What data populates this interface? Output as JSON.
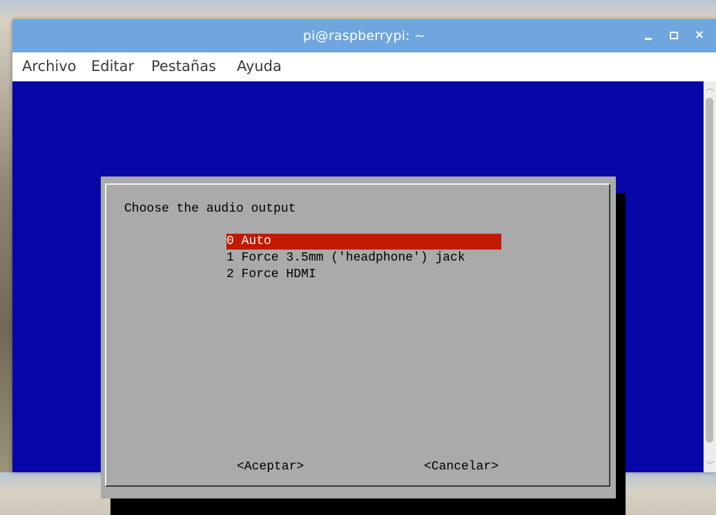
{
  "window": {
    "title": "pi@raspberrypi: ~",
    "controls": {
      "minimize": "_",
      "maximize": "□",
      "close": "×"
    }
  },
  "menubar": {
    "items": [
      "Archivo",
      "Editar",
      "Pestañas",
      "Ayuda"
    ]
  },
  "dialog": {
    "prompt": "Choose the audio output",
    "options": [
      {
        "label": "0 Auto",
        "selected": true
      },
      {
        "label": "1 Force 3.5mm ('headphone') jack",
        "selected": false
      },
      {
        "label": "2 Force HDMI",
        "selected": false
      }
    ],
    "ok_label": "<Aceptar>",
    "cancel_label": "<Cancelar>"
  },
  "colors": {
    "titlebar": "#6fa6dd",
    "terminal_bg": "#0707a7",
    "dialog_bg": "#aaaaaa",
    "selection": "#c11a00"
  }
}
